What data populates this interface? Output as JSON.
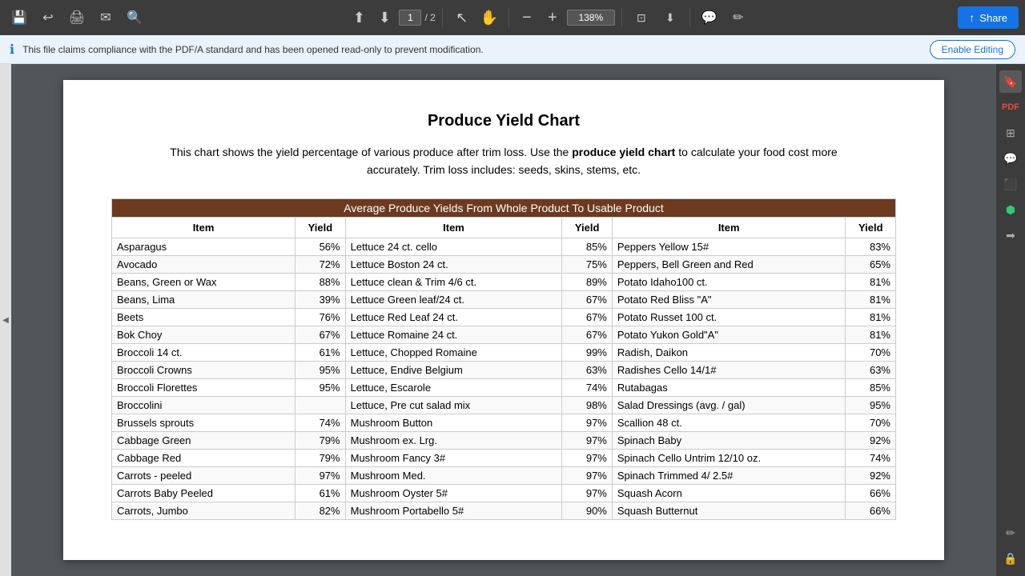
{
  "toolbar": {
    "page_current": "1",
    "page_total": "2",
    "zoom_level": "138%",
    "share_label": "Share"
  },
  "infobar": {
    "message": "This file claims compliance with the PDF/A standard and has been opened read-only to prevent modification.",
    "enable_editing_label": "Enable Editing"
  },
  "document": {
    "title": "Produce Yield Chart",
    "description_part1": "This chart shows the yield percentage of various produce after trim loss.  Use the ",
    "description_highlight": "produce yield chart",
    "description_part2": " to calculate your food cost more accurately.  Trim loss includes: seeds, skins, stems, etc.",
    "table_banner": "Average Produce Yields From Whole Product To Usable Product",
    "col_headers": [
      "Item",
      "Yield",
      "Item",
      "Yield",
      "Item",
      "Yield"
    ],
    "rows": [
      [
        "Asparagus",
        "56%",
        "Lettuce 24 ct. cello",
        "85%",
        "Peppers Yellow 15#",
        "83%"
      ],
      [
        "Avocado",
        "72%",
        "Lettuce Boston 24 ct.",
        "75%",
        "Peppers, Bell Green and Red",
        "65%"
      ],
      [
        "Beans, Green or Wax",
        "88%",
        "Lettuce clean & Trim 4/6 ct.",
        "89%",
        "Potato Idaho100 ct.",
        "81%"
      ],
      [
        "Beans, Lima",
        "39%",
        "Lettuce Green leaf/24 ct.",
        "67%",
        "Potato Red Bliss \"A\"",
        "81%"
      ],
      [
        "Beets",
        "76%",
        "Lettuce Red Leaf 24 ct.",
        "67%",
        "Potato Russet 100 ct.",
        "81%"
      ],
      [
        "Bok Choy",
        "67%",
        "Lettuce Romaine 24 ct.",
        "67%",
        "Potato Yukon Gold\"A\"",
        "81%"
      ],
      [
        "Broccoli 14 ct.",
        "61%",
        "Lettuce, Chopped Romaine",
        "99%",
        "Radish, Daikon",
        "70%"
      ],
      [
        "Broccoli Crowns",
        "95%",
        "Lettuce, Endive Belgium",
        "63%",
        "Radishes Cello 14/1#",
        "63%"
      ],
      [
        "Broccoli Florettes",
        "95%",
        "Lettuce, Escarole",
        "74%",
        "Rutabagas",
        "85%"
      ],
      [
        "Broccolini",
        "",
        "Lettuce, Pre cut salad mix",
        "98%",
        "Salad Dressings (avg. / gal)",
        "95%"
      ],
      [
        "Brussels sprouts",
        "74%",
        "Mushroom Button",
        "97%",
        "Scallion 48 ct.",
        "70%"
      ],
      [
        "Cabbage Green",
        "79%",
        "Mushroom ex. Lrg.",
        "97%",
        "Spinach Baby",
        "92%"
      ],
      [
        "Cabbage Red",
        "79%",
        "Mushroom Fancy 3#",
        "97%",
        "Spinach Cello Untrim 12/10 oz.",
        "74%"
      ],
      [
        "Carrots - peeled",
        "97%",
        "Mushroom Med.",
        "97%",
        "Spinach Trimmed 4/ 2.5#",
        "92%"
      ],
      [
        "Carrots Baby Peeled",
        "61%",
        "Mushroom Oyster 5#",
        "97%",
        "Squash Acorn",
        "66%"
      ],
      [
        "Carrots, Jumbo",
        "82%",
        "Mushroom Portabello 5#",
        "90%",
        "Squash Butternut",
        "66%"
      ]
    ]
  }
}
